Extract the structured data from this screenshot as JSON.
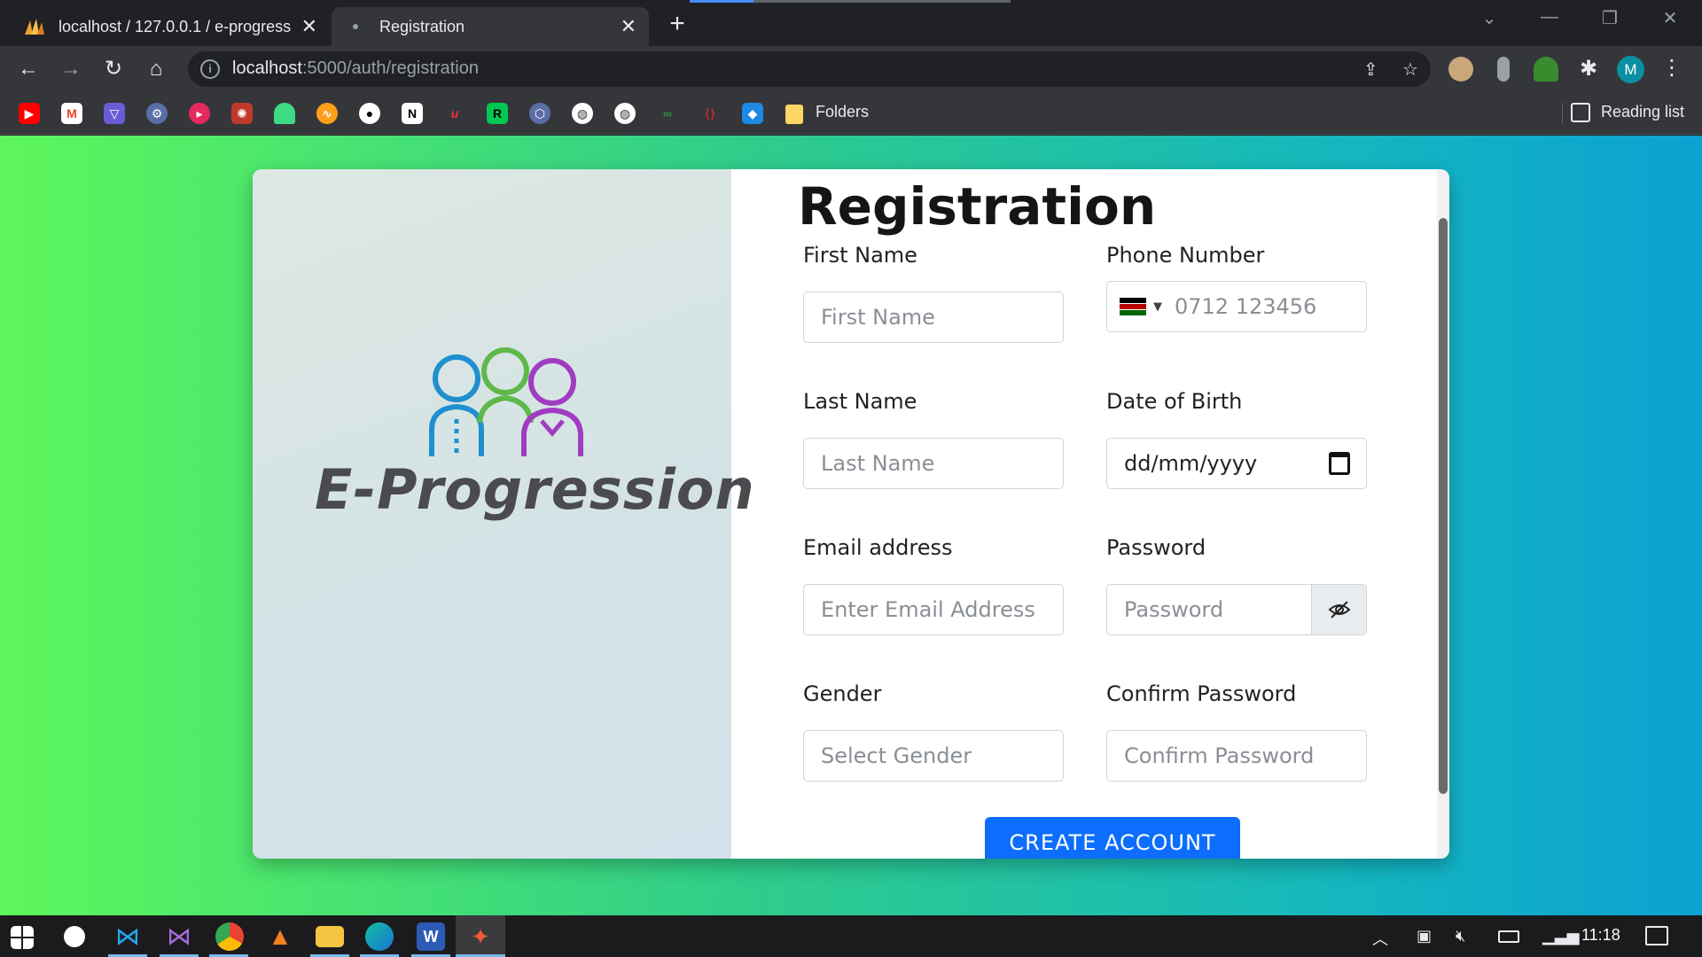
{
  "browser": {
    "tabs": [
      {
        "title": "localhost / 127.0.0.1 / e-progress",
        "active": false,
        "icon": "phpmyadmin-icon"
      },
      {
        "title": "Registration",
        "active": true,
        "icon": "loading-icon"
      }
    ],
    "url_host": "localhost",
    "url_path": ":5000/auth/registration",
    "profile_initial": "M",
    "bookmarks_folder_label": "Folders",
    "reading_list_label": "Reading list"
  },
  "brand": {
    "logo_text": "E-Progression"
  },
  "form": {
    "title": "Registration",
    "first_name": {
      "label": "First Name",
      "placeholder": "First Name"
    },
    "phone": {
      "label": "Phone Number",
      "placeholder": "0712 123456",
      "country": "KE"
    },
    "last_name": {
      "label": "Last Name",
      "placeholder": "Last Name"
    },
    "dob": {
      "label": "Date of Birth",
      "value": "dd/mm/yyyy"
    },
    "email": {
      "label": "Email address",
      "placeholder": "Enter Email Address"
    },
    "password": {
      "label": "Password",
      "placeholder": "Password"
    },
    "gender": {
      "label": "Gender",
      "placeholder": "Select Gender"
    },
    "confirm_password": {
      "label": "Confirm Password",
      "placeholder": "Confirm Password"
    },
    "submit_label": "CREATE ACCOUNT"
  },
  "taskbar": {
    "clock": "11:18"
  },
  "colors": {
    "accent": "#0d6efd",
    "gradient_start": "#5ef65c",
    "gradient_end": "#0ca2d2",
    "profile": "#0b8fa3"
  }
}
